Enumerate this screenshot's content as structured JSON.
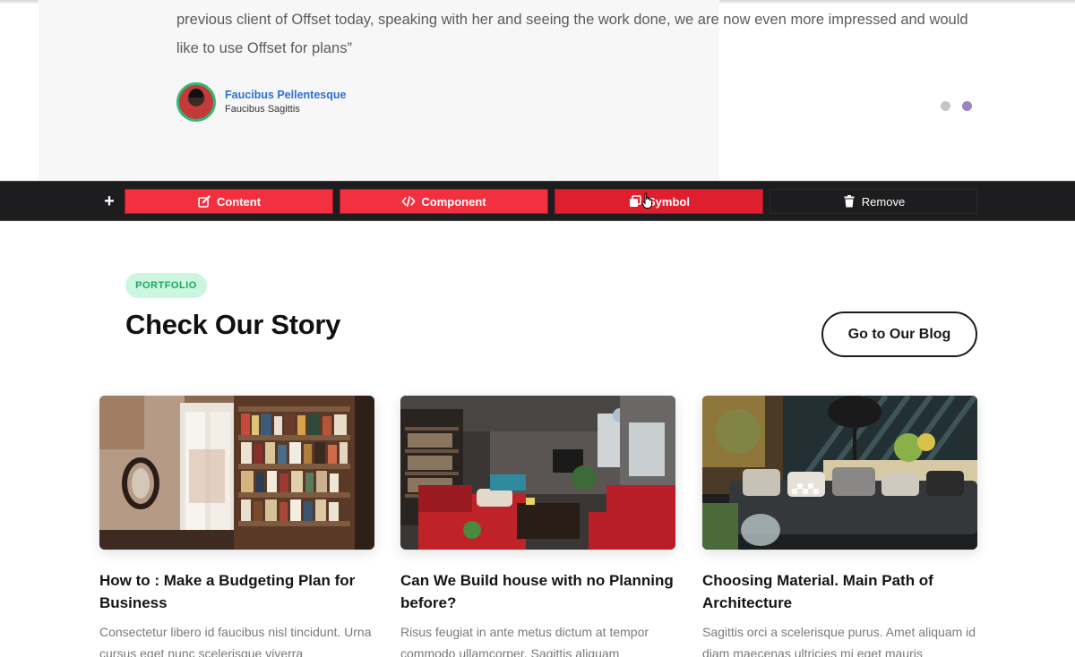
{
  "testimonial": {
    "quote": "previous client of Offset today, speaking with her and seeing the work done, we are now even more impressed and would like to use Offset for plans”",
    "author_name": "Faucibus Pellentesque",
    "author_role": "Faucibus Sagittis",
    "slides": 2,
    "active_slide": 2
  },
  "toolbar": {
    "add_label": "+",
    "content_label": "Content",
    "component_label": "Component",
    "symbol_label": "Symbol",
    "remove_label": "Remove",
    "icons": [
      "edit-icon",
      "code-icon",
      "copy-icon",
      "trash-icon"
    ],
    "accent_color": "#f2303f"
  },
  "portfolio": {
    "badge": "PORTFOLIO",
    "title": "Check Our Story",
    "blog_button": "Go to Our Blog",
    "badge_color": "#ccf6df",
    "cards": [
      {
        "title": "How to : Make a Budgeting Plan for Business",
        "text": "Consectetur libero id faucibus nisl tincidunt. Urna cursus eget nunc scelerisque viverra"
      },
      {
        "title": "Can We Build house with no Planning before?",
        "text": "Risus feugiat in ante metus dictum at tempor commodo ullamcorper. Sagittis aliquam"
      },
      {
        "title": "Choosing Material. Main Path of Architecture",
        "text": "Sagittis orci a scelerisque purus. Amet aliquam id diam maecenas ultricies mi eget mauris"
      }
    ]
  }
}
